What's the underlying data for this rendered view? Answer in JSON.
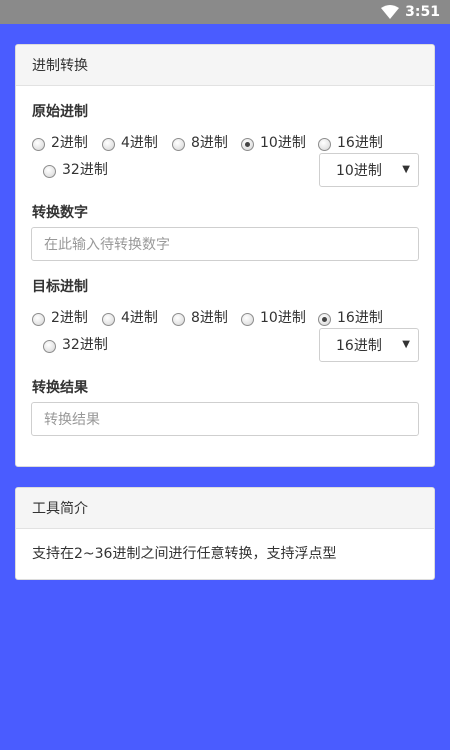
{
  "status_bar": {
    "time": "3:51"
  },
  "converter": {
    "title": "进制转换",
    "source": {
      "label": "原始进制",
      "options": [
        "2进制",
        "4进制",
        "8进制",
        "10进制",
        "16进制",
        "32进制"
      ],
      "selected": "10进制",
      "dropdown_value": "10进制"
    },
    "number": {
      "label": "转换数字",
      "placeholder": "在此输入待转换数字"
    },
    "target": {
      "label": "目标进制",
      "options": [
        "2进制",
        "4进制",
        "8进制",
        "10进制",
        "16进制",
        "32进制"
      ],
      "selected": "16进制",
      "dropdown_value": "16进制"
    },
    "result": {
      "label": "转换结果",
      "placeholder": "转换结果"
    }
  },
  "intro": {
    "title": "工具简介",
    "text": "支持在2~36进制之间进行任意转换，支持浮点型"
  }
}
